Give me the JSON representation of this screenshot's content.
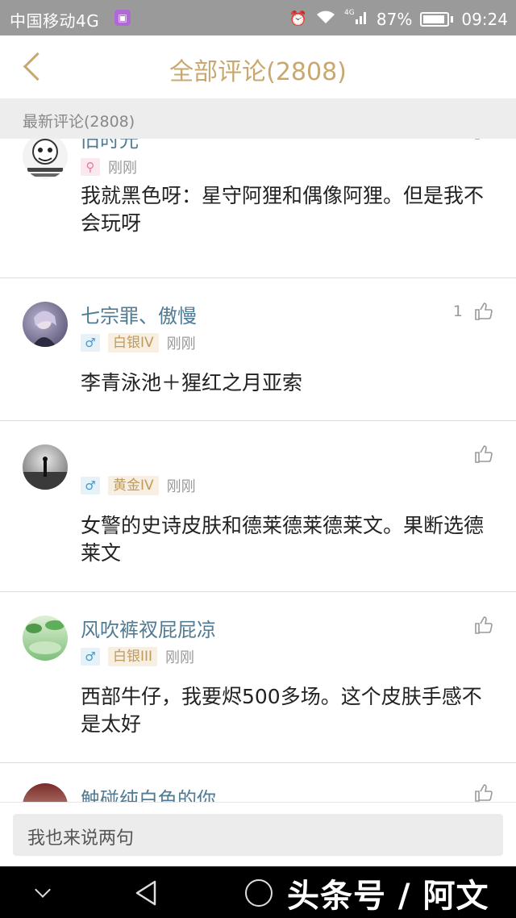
{
  "status_bar": {
    "carrier": "中国移动4G",
    "network": "4G",
    "battery": "87%",
    "time": "09:24"
  },
  "header": {
    "title": "全部评论(2808)"
  },
  "section": {
    "label": "最新评论(2808)"
  },
  "comments": [
    {
      "username": "旧时光",
      "gender": "female",
      "rank": "",
      "time": "刚刚",
      "likes": "",
      "content": "我就黑色呀：星守阿狸和偶像阿狸。但是我不会玩呀"
    },
    {
      "username": "七宗罪、傲慢",
      "gender": "male",
      "rank": "白银IV",
      "time": "刚刚",
      "likes": "1",
      "content": "李青泳池＋猩红之月亚索"
    },
    {
      "username": "",
      "gender": "male",
      "rank": "黄金IV",
      "time": "刚刚",
      "likes": "",
      "content": "女警的史诗皮肤和德莱德莱德莱文。果断选德莱文"
    },
    {
      "username": "风吹裤衩屁屁凉",
      "gender": "male",
      "rank": "白银III",
      "time": "刚刚",
      "likes": "",
      "content": "西部牛仔，我要烬500多场。这个皮肤手感不是太好"
    },
    {
      "username": "触碰纯白色的你",
      "gender": "",
      "rank": "",
      "time": "",
      "likes": "",
      "content": ""
    }
  ],
  "input": {
    "placeholder": "我也来说两句"
  },
  "watermark": "头条号 / 阿文",
  "icons": {
    "male": "♂",
    "female": "⚲"
  },
  "colors": {
    "accent": "#c8a870",
    "username": "#4f7c94",
    "rank_text": "#c09a5b",
    "rank_bg": "#f6efe2"
  }
}
